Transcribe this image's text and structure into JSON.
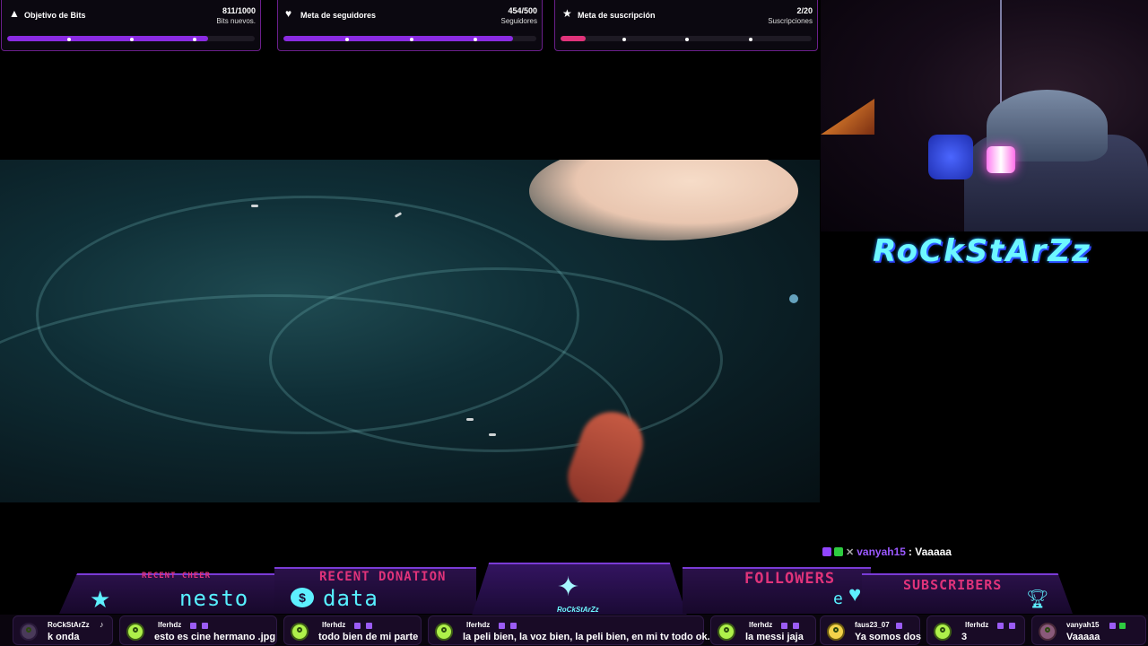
{
  "goals": [
    {
      "title": "Objetivo de Bits",
      "count": "811/1000",
      "sub": "Bits nuevos.",
      "progress": 0.811,
      "color": "#8a2be2",
      "icon": "cheer-triangle-icon"
    },
    {
      "title": "Meta de seguidores",
      "count": "454/500",
      "sub": "Seguidores",
      "progress": 0.908,
      "color": "#8a2be2",
      "icon": "heart-follow-icon"
    },
    {
      "title": "Meta de suscripción",
      "count": "2/20",
      "sub": "Suscripciones",
      "progress": 0.1,
      "color": "#e0337a",
      "icon": "star-sub-icon"
    }
  ],
  "logo": "RoCkStArZz",
  "chat_highlight": {
    "user": "vanyah15",
    "text": ": Vaaaaa"
  },
  "bottom_panel": {
    "recent_cheer_label": "RECENT CHEER",
    "recent_cheer_value": "nesto",
    "recent_donation_label": "RECENT DONATION",
    "recent_donation_value": "data",
    "followers_label": "FOLLOWERS",
    "followers_value": "e",
    "subscribers_label": "SUBSCRIBERS",
    "center_logo": "RoCkStArZz"
  },
  "ticker": [
    {
      "user": "RoCkStArZz",
      "text": "k onda"
    },
    {
      "user": "lferhdz",
      "text": "esto es cine hermano .jpg"
    },
    {
      "user": "lferhdz",
      "text": "todo bien de mi parte"
    },
    {
      "user": "lferhdz",
      "text": "la peli bien, la voz bien, la peli bien, en mi tv todo ok."
    },
    {
      "user": "lferhdz",
      "text": "la messi jaja"
    },
    {
      "user": "faus23_07",
      "text": "Ya somos dos"
    },
    {
      "user": "lferhdz",
      "text": "3"
    },
    {
      "user": "vanyah15",
      "text": "Vaaaaa"
    }
  ]
}
